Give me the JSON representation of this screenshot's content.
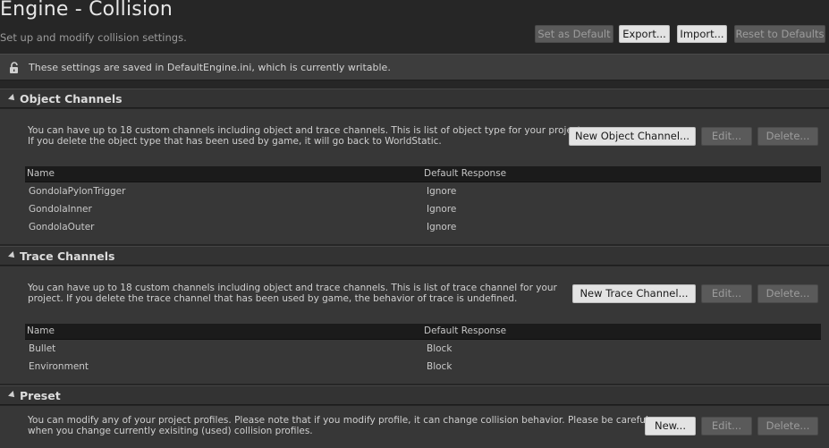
{
  "header": {
    "title": "Engine - Collision",
    "subtitle": "Set up and modify collision settings.",
    "buttons": {
      "set_default": "Set as Default",
      "export": "Export...",
      "import": "Import...",
      "reset": "Reset to Defaults"
    }
  },
  "notice": {
    "icon": "unlock-icon",
    "text": "These settings are saved in DefaultEngine.ini, which is currently writable."
  },
  "object_channels": {
    "title": "Object Channels",
    "desc_line1": "You can have up to 18 custom channels including object and trace channels. This is list of object type for your project.",
    "desc_line2": "If you delete the object type that has been used by game, it will go back to WorldStatic.",
    "new_button": "New Object Channel...",
    "edit_button": "Edit...",
    "delete_button": "Delete...",
    "columns": {
      "name": "Name",
      "response": "Default Response"
    },
    "rows": [
      {
        "name": "GondolaPylonTrigger",
        "response": "Ignore"
      },
      {
        "name": "GondolaInner",
        "response": "Ignore"
      },
      {
        "name": "GondolaOuter",
        "response": "Ignore"
      }
    ]
  },
  "trace_channels": {
    "title": "Trace Channels",
    "desc_line1": "You can have up to 18 custom channels including object and trace channels. This is list of trace channel for your",
    "desc_line2": "project. If you delete the trace channel that has been used by game, the behavior of trace is undefined.",
    "new_button": "New Trace Channel...",
    "edit_button": "Edit...",
    "delete_button": "Delete...",
    "columns": {
      "name": "Name",
      "response": "Default Response"
    },
    "rows": [
      {
        "name": "Bullet",
        "response": "Block"
      },
      {
        "name": "Environment",
        "response": "Block"
      }
    ]
  },
  "preset": {
    "title": "Preset",
    "desc_line1": "You can modify any of your project profiles. Please note that if you modify profile, it can change collision behavior. Please be careful",
    "desc_line2": "when you change currently exisiting (used) collision profiles.",
    "new_button": "New...",
    "edit_button": "Edit...",
    "delete_button": "Delete..."
  },
  "colors": {
    "background": "#262626",
    "section_header": "#333333",
    "section_body": "#373737",
    "table_header": "#1b1b1b"
  }
}
